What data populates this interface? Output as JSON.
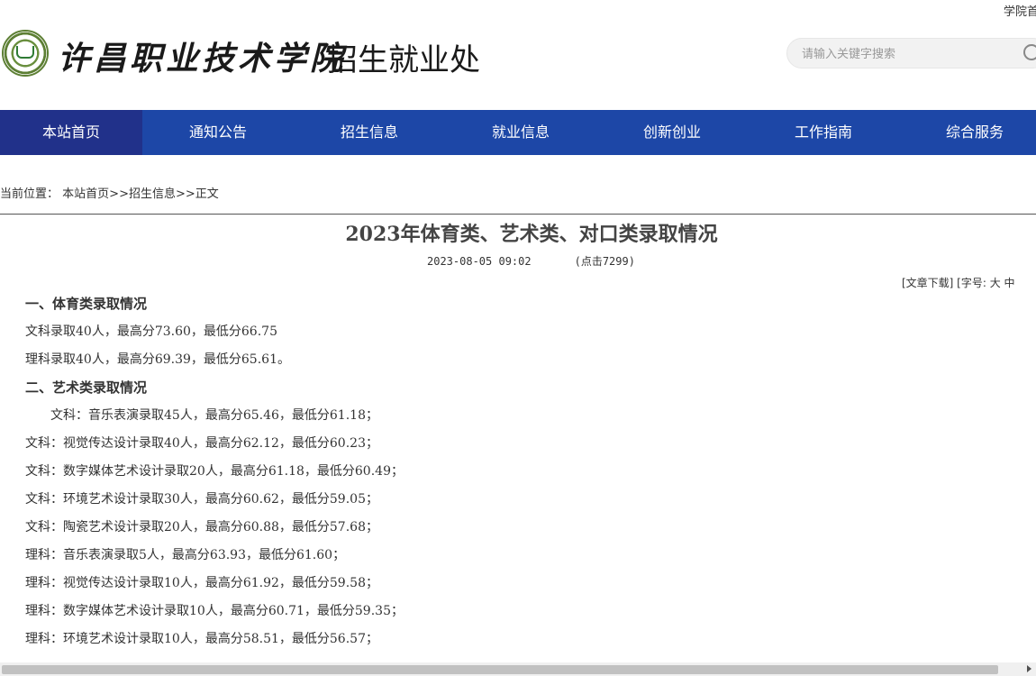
{
  "top_link": "学院首",
  "header": {
    "school_name": "许昌职业技术学院",
    "dept_name": "招生就业处",
    "search": {
      "placeholder": "请输入关键字搜索"
    }
  },
  "nav": {
    "items": [
      {
        "label": "本站首页",
        "active": true
      },
      {
        "label": "通知公告"
      },
      {
        "label": "招生信息"
      },
      {
        "label": "就业信息"
      },
      {
        "label": "创新创业"
      },
      {
        "label": "工作指南"
      },
      {
        "label": "综合服务"
      }
    ]
  },
  "breadcrumb": {
    "prefix": "当前位置：",
    "home": "本站首页",
    "sep1": ">>",
    "section": "招生信息",
    "sep2": ">>",
    "current": "正文"
  },
  "article": {
    "title": "2023年体育类、艺术类、对口类录取情况",
    "date": "2023-08-05 09:02",
    "clicks": "(点击7299)",
    "tools": "[文章下载] [字号: 大 中",
    "paragraphs": [
      {
        "text": "一、体育类录取情况",
        "type": "heading"
      },
      {
        "text": "文科录取40人，最高分73.60，最低分66.75"
      },
      {
        "text": "理科录取40人，最高分69.39，最低分65.61。"
      },
      {
        "text": "二、艺术类录取情况",
        "type": "heading"
      },
      {
        "text": "文科：音乐表演录取45人，最高分65.46，最低分61.18；",
        "type": "indent"
      },
      {
        "text": "文科：视觉传达设计录取40人，最高分62.12，最低分60.23；"
      },
      {
        "text": "文科：数字媒体艺术设计录取20人，最高分61.18，最低分60.49；"
      },
      {
        "text": "文科：环境艺术设计录取30人，最高分60.62，最低分59.05；"
      },
      {
        "text": "文科：陶瓷艺术设计录取20人，最高分60.88，最低分57.68；"
      },
      {
        "text": "理科：音乐表演录取5人，最高分63.93，最低分61.60；"
      },
      {
        "text": "理科：视觉传达设计录取10人，最高分61.92，最低分59.58；"
      },
      {
        "text": "理科：数字媒体艺术设计录取10人，最高分60.71，最低分59.35；"
      },
      {
        "text": "理科：环境艺术设计录取10人，最高分58.51，最低分56.57；"
      }
    ]
  }
}
